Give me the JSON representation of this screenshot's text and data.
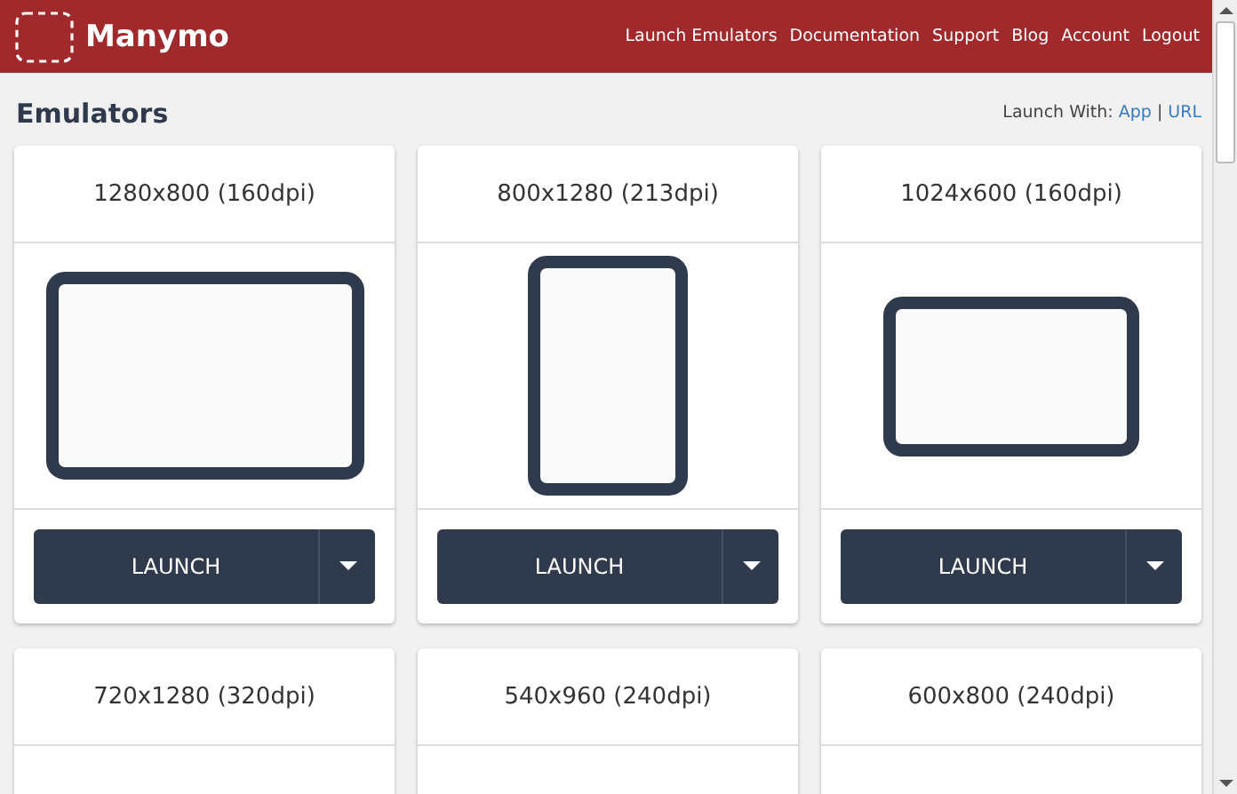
{
  "header": {
    "logo": "Manymo",
    "nav": [
      "Launch Emulators",
      "Documentation",
      "Support",
      "Blog",
      "Account",
      "Logout"
    ]
  },
  "page": {
    "title": "Emulators",
    "launch_with": {
      "label": "Launch With:",
      "options": [
        {
          "label": "App"
        },
        {
          "label": "URL"
        }
      ],
      "separator": "|"
    }
  },
  "emulators": [
    {
      "name": "1280x800 (160dpi)",
      "kind": "landscape-large",
      "button": "LAUNCH"
    },
    {
      "name": "800x1280 (213dpi)",
      "kind": "portrait",
      "button": "LAUNCH"
    },
    {
      "name": "1024x600 (160dpi)",
      "kind": "landscape-small",
      "button": "LAUNCH"
    },
    {
      "name": "720x1280 (320dpi)"
    },
    {
      "name": "540x960 (240dpi)"
    },
    {
      "name": "600x800 (240dpi)"
    }
  ]
}
